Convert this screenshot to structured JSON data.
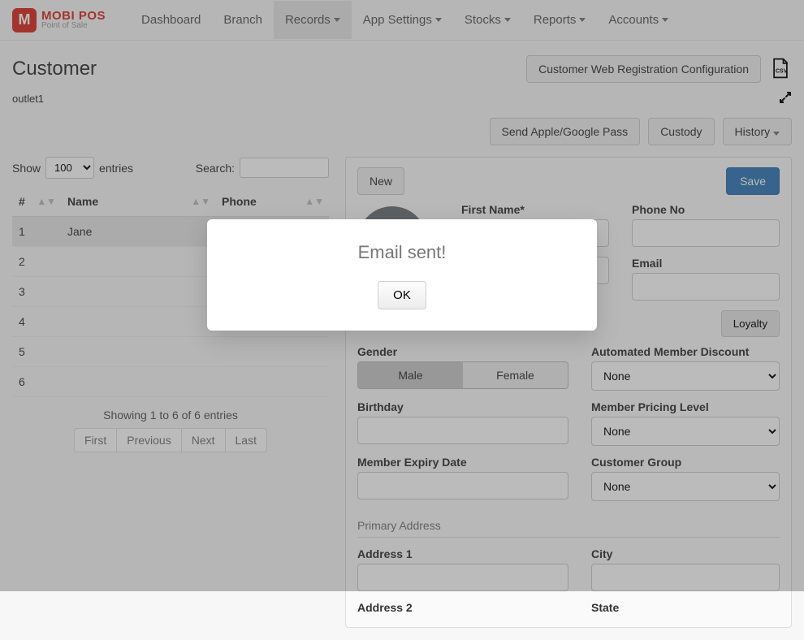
{
  "brand": {
    "title": "MOBI POS",
    "sub": "Point of Sale",
    "icon_letter": "M"
  },
  "nav": {
    "items": [
      {
        "label": "Dashboard",
        "dropdown": false,
        "active": false
      },
      {
        "label": "Branch",
        "dropdown": false,
        "active": false
      },
      {
        "label": "Records",
        "dropdown": true,
        "active": true
      },
      {
        "label": "App Settings",
        "dropdown": true,
        "active": false
      },
      {
        "label": "Stocks",
        "dropdown": true,
        "active": false
      },
      {
        "label": "Reports",
        "dropdown": true,
        "active": false
      },
      {
        "label": "Accounts",
        "dropdown": true,
        "active": false
      }
    ]
  },
  "page": {
    "title": "Customer",
    "web_reg_btn": "Customer Web Registration Configuration",
    "outlet": "outlet1"
  },
  "actions": {
    "send_pass": "Send Apple/Google Pass",
    "custody": "Custody",
    "history": "History"
  },
  "datatable": {
    "show_label_pre": "Show",
    "show_label_post": "entries",
    "length_value": "100",
    "search_label": "Search:",
    "search_value": "",
    "columns": [
      "#",
      "Name",
      "Phone"
    ],
    "rows": [
      {
        "num": "1",
        "name": "Jane",
        "phone": ""
      },
      {
        "num": "2",
        "name": "",
        "phone": ""
      },
      {
        "num": "3",
        "name": "",
        "phone": ""
      },
      {
        "num": "4",
        "name": "",
        "phone": ""
      },
      {
        "num": "5",
        "name": "",
        "phone": ""
      },
      {
        "num": "6",
        "name": "",
        "phone": ""
      }
    ],
    "info": "Showing 1 to 6 of 6 entries",
    "pager": {
      "first": "First",
      "prev": "Previous",
      "next": "Next",
      "last": "Last"
    }
  },
  "panel": {
    "new_btn": "New",
    "save_btn": "Save",
    "fields": {
      "first_name": {
        "label": "First Name*",
        "value": ""
      },
      "phone": {
        "label": "Phone No",
        "value": ""
      },
      "last_name_hidden_label": "",
      "email": {
        "label": "Email",
        "value": ""
      },
      "loyalty_btn": "Loyalty",
      "gender": {
        "label": "Gender",
        "male": "Male",
        "female": "Female",
        "selected": "Male"
      },
      "auto_member_discount": {
        "label": "Automated Member Discount",
        "value": "None"
      },
      "birthday": {
        "label": "Birthday",
        "value": ""
      },
      "member_pricing": {
        "label": "Member Pricing Level",
        "value": "None"
      },
      "member_expiry": {
        "label": "Member Expiry Date",
        "value": ""
      },
      "customer_group": {
        "label": "Customer Group",
        "value": "None"
      },
      "primary_address_section": "Primary Address",
      "address1": {
        "label": "Address 1",
        "value": ""
      },
      "city": {
        "label": "City",
        "value": ""
      },
      "address2": {
        "label": "Address 2"
      },
      "state": {
        "label": "State"
      }
    }
  },
  "modal": {
    "title": "Email sent!",
    "ok": "OK"
  }
}
